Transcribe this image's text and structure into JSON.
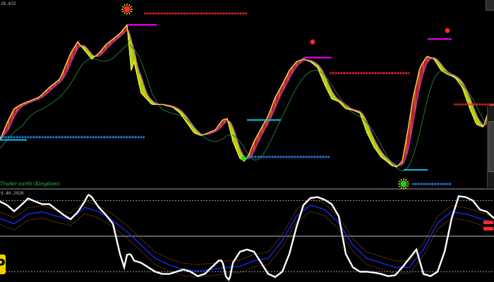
{
  "labels": {
    "price_top": "26.632",
    "osc_top": "9.40.2920",
    "watermark": "Trader earth (Kingdom)",
    "logo": "P"
  },
  "colors": {
    "background": "#000000",
    "bull_fill": "#b8242a",
    "bear_fill": "#9ed400",
    "price_line": "#ffeb3b",
    "fast_ma": "#c02cc8",
    "slow_ma": "#1f7a2e",
    "support_line": "#00c8e6",
    "resistance_line": "#ff00ff",
    "red_cross": "#ff2a2a",
    "blue_cross": "#2b8fff",
    "osc_main": "#ffffff",
    "osc_signal": "#1a2aff",
    "osc_band": "#c2621a"
  },
  "icons": {
    "top_marker": "sun-marker-icon",
    "bottom_marker": "sun-marker-icon",
    "sell_dot": "red-dot-icon",
    "buy_dot": "green-dot-icon"
  },
  "chart_data": [
    {
      "type": "line",
      "series": [
        {
          "name": "",
          "x": [
            0,
            10,
            20,
            30,
            40,
            55,
            70,
            85,
            100,
            110,
            120,
            130,
            140,
            150,
            160,
            170,
            180,
            186,
            190,
            200,
            215,
            230,
            245,
            255,
            265,
            275,
            285,
            295,
            305,
            315,
            322,
            330,
            340,
            346,
            352,
            360,
            370,
            380,
            390,
            400,
            410,
            420,
            430,
            440,
            450,
            460,
            470,
            480,
            490,
            500,
            510,
            520,
            530,
            540,
            548,
            555,
            562,
            570,
            578,
            585,
            595,
            605,
            615,
            625,
            635,
            645,
            655,
            665,
            675,
            685,
            695
          ],
          "y": [
            33,
            45,
            55,
            58,
            60,
            63,
            70,
            76,
            94,
            102,
            96,
            90,
            94,
            100,
            104,
            108,
            114,
            82,
            88,
            66,
            58,
            58,
            56,
            52,
            45,
            38,
            36,
            38,
            40,
            47,
            48,
            32,
            20,
            18,
            22,
            32,
            41,
            50,
            63,
            72,
            82,
            88,
            90,
            88,
            84,
            72,
            62,
            60,
            55,
            54,
            52,
            38,
            28,
            21,
            18,
            15,
            14,
            18,
            40,
            62,
            84,
            92,
            90,
            82,
            79,
            77,
            70,
            56,
            44,
            42,
            58
          ]
        }
      ]
    },
    {
      "type": "line",
      "series": [
        {
          "name": "",
          "x": [
            0,
            10,
            20,
            30,
            40,
            50,
            60,
            70,
            80,
            90,
            100,
            110,
            120,
            125,
            130,
            140,
            150,
            160,
            170,
            176,
            180,
            185,
            190,
            200,
            210,
            220,
            230,
            240,
            250,
            260,
            270,
            280,
            290,
            300,
            310,
            315,
            320,
            325,
            330,
            340,
            350,
            360,
            370,
            380,
            390,
            400,
            405,
            410,
            420,
            430,
            440,
            450,
            460,
            470,
            480,
            490,
            500,
            510,
            520,
            530,
            540,
            550,
            560,
            570,
            580,
            590,
            600,
            610,
            620,
            630,
            640,
            650,
            660,
            670,
            680,
            690,
            700
          ],
          "y": [
            78,
            70,
            56,
            70,
            85,
            78,
            72,
            72,
            60,
            48,
            38,
            54,
            78,
            94,
            88,
            65,
            48,
            28,
            -40,
            -70,
            -42,
            -40,
            -55,
            -60,
            -70,
            -80,
            -85,
            -85,
            -80,
            -75,
            -80,
            -90,
            -85,
            -70,
            -55,
            -55,
            -90,
            -100,
            -60,
            -35,
            -30,
            -35,
            -60,
            -85,
            -92,
            -80,
            -60,
            -40,
            20,
            70,
            86,
            88,
            82,
            72,
            45,
            -40,
            -70,
            -80,
            -80,
            -82,
            -85,
            -90,
            -88,
            -70,
            -50,
            -30,
            -85,
            -90,
            -80,
            -35,
            40,
            90,
            88,
            80,
            60,
            55,
            40
          ]
        },
        {
          "name": "",
          "x": [
            0,
            20,
            40,
            60,
            80,
            100,
            120,
            140,
            160,
            180,
            200,
            220,
            240,
            260,
            280,
            300,
            320,
            340,
            360,
            380,
            400,
            420,
            440,
            460,
            480,
            500,
            520,
            540,
            560,
            580,
            600,
            620,
            640,
            660,
            680,
            700
          ],
          "y": [
            40,
            28,
            50,
            55,
            45,
            38,
            65,
            55,
            35,
            10,
            -20,
            -50,
            -65,
            -75,
            -78,
            -75,
            -70,
            -68,
            -55,
            -50,
            -10,
            45,
            70,
            60,
            30,
            -20,
            -50,
            -60,
            -70,
            -70,
            -30,
            30,
            55,
            50,
            40,
            30
          ]
        }
      ]
    }
  ]
}
